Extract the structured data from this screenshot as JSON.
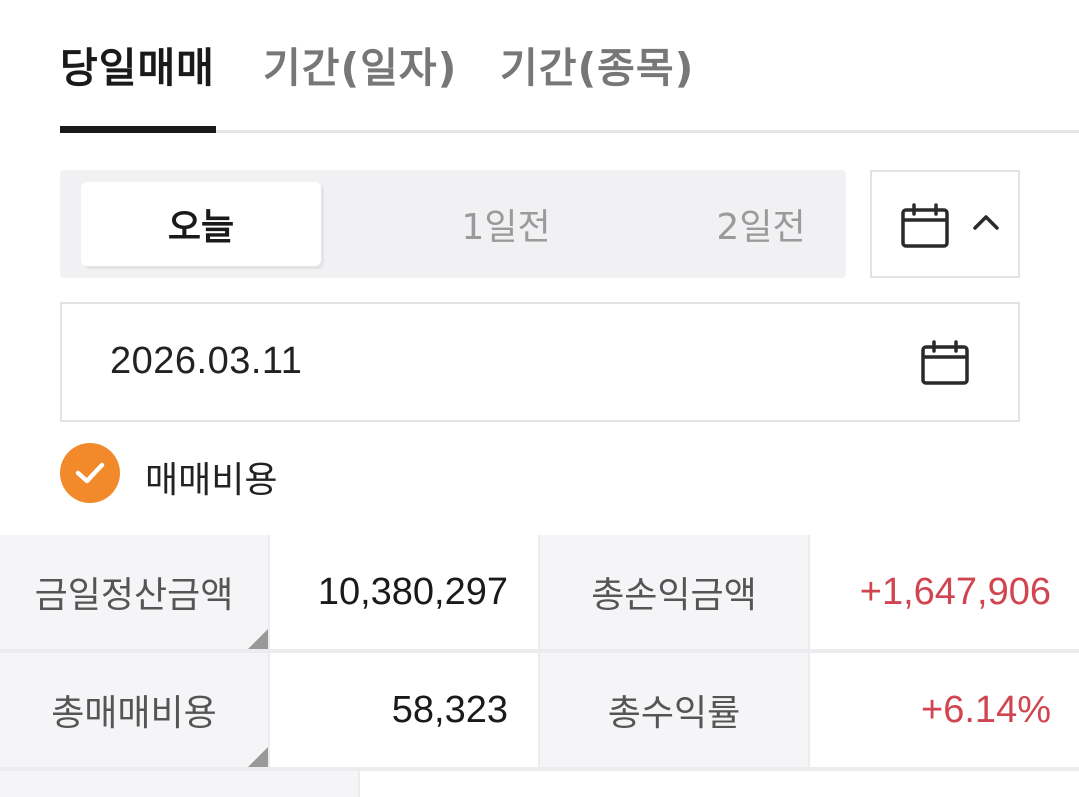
{
  "tabs": [
    {
      "label": "당일매매",
      "active": true
    },
    {
      "label": "기간(일자)",
      "active": false
    },
    {
      "label": "기간(종목)",
      "active": false
    }
  ],
  "day_selector": {
    "options": [
      "오늘",
      "1일전",
      "2일전"
    ],
    "selected": "오늘"
  },
  "calendar_toggle": {
    "icon": "calendar-icon",
    "chevron": "chevron-up-icon"
  },
  "date_field": {
    "value": "2026.03.11",
    "icon": "calendar-icon"
  },
  "fee_checkbox": {
    "label": "매매비용",
    "checked": true,
    "color": "#f28a2c"
  },
  "summary": {
    "settlement_label": "금일정산금액",
    "settlement_value": "10,380,297",
    "total_pl_label": "총손익금액",
    "total_pl_value": "+1,647,906",
    "total_fee_label": "총매매비용",
    "total_fee_value": "58,323",
    "return_label": "총수익률",
    "return_value": "+6.14%",
    "positive_color": "#d0454f"
  }
}
